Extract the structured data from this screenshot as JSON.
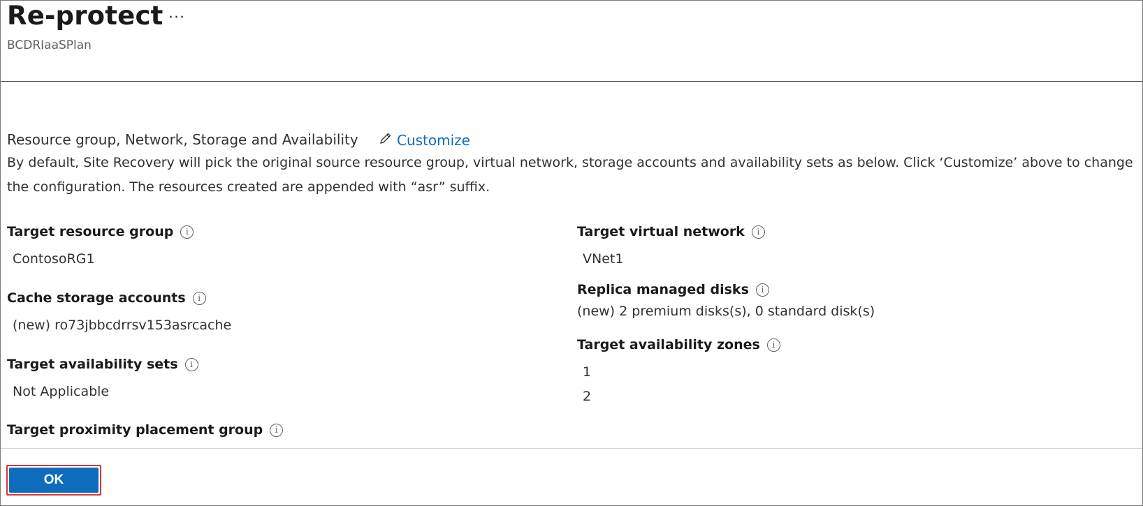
{
  "header": {
    "title": "Re-protect",
    "more_label": "···",
    "subtitle": "BCDRIaaSPlan"
  },
  "section": {
    "title": "Resource group, Network, Storage and Availability",
    "customize_label": "Customize",
    "description": "By default, Site Recovery will pick the original source resource group, virtual network, storage accounts and availability sets as below. Click ‘Customize’ above to change the configuration. The resources created are appended with “asr” suffix."
  },
  "left_fields": {
    "target_resource_group": {
      "label": "Target resource group",
      "value": "ContosoRG1"
    },
    "cache_storage_accounts": {
      "label": "Cache storage accounts",
      "value": "(new) ro73jbbcdrrsv153asrcache"
    },
    "target_availability_sets": {
      "label": "Target availability sets",
      "value": "Not Applicable"
    },
    "target_proximity_placement_group": {
      "label": "Target proximity placement group"
    }
  },
  "right_fields": {
    "target_virtual_network": {
      "label": "Target virtual network",
      "value": "VNet1"
    },
    "replica_managed_disks": {
      "label": "Replica managed disks",
      "value": "(new) 2 premium disks(s), 0 standard disk(s)"
    },
    "target_availability_zones": {
      "label": "Target availability zones",
      "values": [
        "1",
        "2"
      ]
    }
  },
  "footer": {
    "ok_label": "OK"
  },
  "icons": {
    "info": "info-icon",
    "edit": "pencil-icon"
  },
  "colors": {
    "link": "#0f6cbd",
    "primary_button": "#0f6cbd",
    "highlight_outline": "#e0323a"
  }
}
